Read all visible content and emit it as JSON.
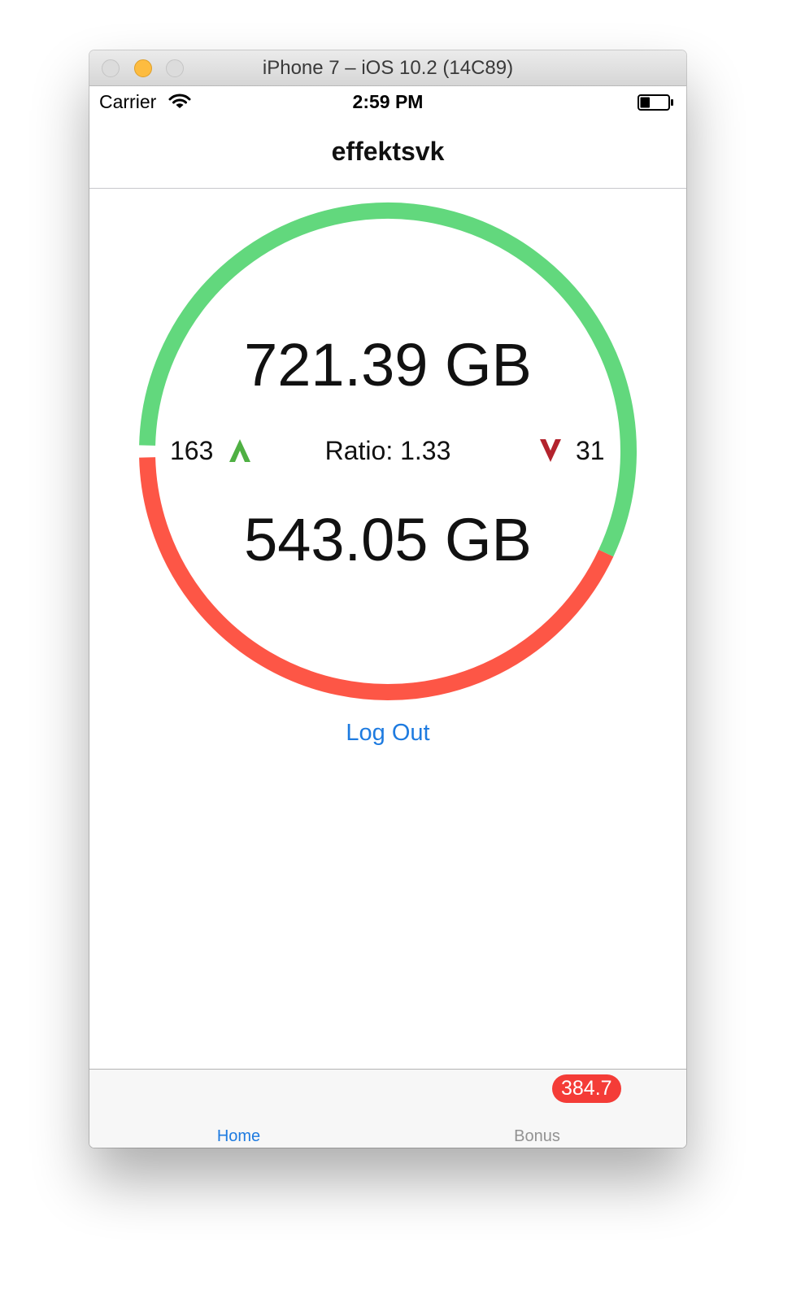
{
  "window": {
    "title": "iPhone 7 – iOS 10.2 (14C89)"
  },
  "status_bar": {
    "carrier": "Carrier",
    "time": "2:59 PM",
    "battery_level": 0.35
  },
  "nav": {
    "title": "effektsvk"
  },
  "stats": {
    "uploaded": "721.39 GB",
    "downloaded": "543.05 GB",
    "ratio_text": "Ratio: 1.33",
    "seeding_count": "163",
    "leeching_count": "31",
    "upload_share": 0.57,
    "colors": {
      "upload": "#62d87d",
      "download": "#fd5646",
      "up_arrow": "#4fb043",
      "down_arrow": "#b3232d"
    }
  },
  "actions": {
    "logout_label": "Log Out"
  },
  "tab_bar": {
    "home_label": "Home",
    "bonus_label": "Bonus",
    "bonus_badge": "384.7",
    "accent": "#1e7be0"
  },
  "icons": {
    "up": "up-arrow-icon",
    "down": "down-arrow-icon",
    "wifi": "wifi-icon",
    "battery": "battery-icon"
  }
}
